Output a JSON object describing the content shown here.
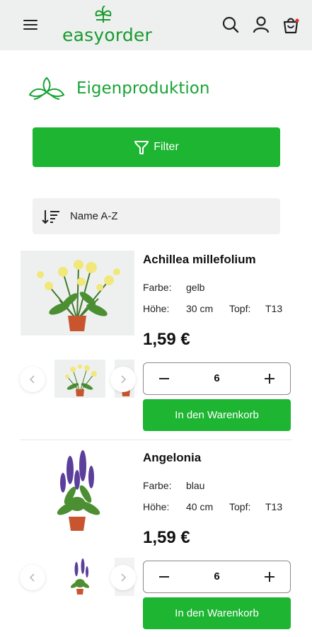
{
  "header": {
    "logo_text": "easyorder",
    "icons": [
      "menu-icon",
      "search-icon",
      "user-icon",
      "cart-icon"
    ],
    "brand_color": "#1a9a2f"
  },
  "category": {
    "title": "Eigenproduktion",
    "icon": "leaf-logo-icon"
  },
  "filter": {
    "label": "Filter",
    "icon": "filter-icon"
  },
  "sort": {
    "label": "Name A-Z",
    "icon": "sort-icon"
  },
  "products": [
    {
      "name": "Achillea millefolium",
      "color_label": "Farbe:",
      "color_value": "gelb",
      "height_label": "Höhe:",
      "height_value": "30 cm",
      "pot_label": "Topf:",
      "pot_value": "T13",
      "price": "1,59 €",
      "quantity": "6",
      "cart_label": "In den Warenkorb",
      "flower_color": "#f2e77a"
    },
    {
      "name": "Angelonia",
      "color_label": "Farbe:",
      "color_value": "blau",
      "height_label": "Höhe:",
      "height_value": "40 cm",
      "pot_label": "Topf:",
      "pot_value": "T13",
      "price": "1,59 €",
      "quantity": "6",
      "cart_label": "In den Warenkorb",
      "flower_color": "#5b3f9a"
    }
  ],
  "accent_color": "#1db532"
}
